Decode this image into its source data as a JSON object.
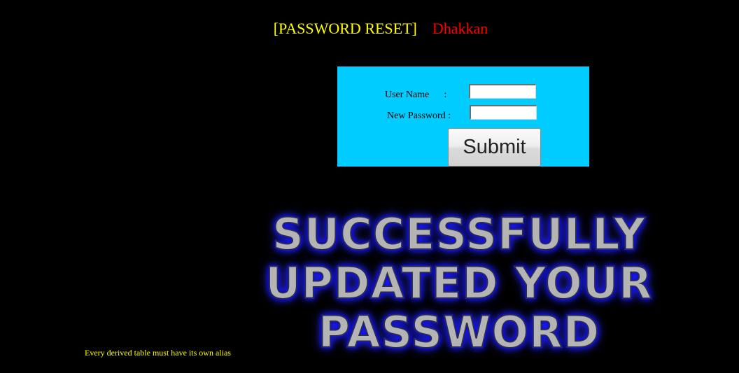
{
  "header": {
    "title": "[PASSWORD RESET]",
    "user": "Dhakkan"
  },
  "form": {
    "username_label": "User Name      :",
    "username_value": "",
    "password_label": "New Password :",
    "password_value": "",
    "submit_label": "Submit"
  },
  "banner": {
    "lines": [
      "SUCCESSFULLY",
      "UPDATED YOUR",
      "PASSWORD"
    ]
  },
  "error_message": "Every derived table must have its own alias",
  "colors": {
    "background": "#000000",
    "title": "#ffff00",
    "user": "#ff0000",
    "form_background": "#00ccff",
    "banner_glow": "#0000ff"
  }
}
